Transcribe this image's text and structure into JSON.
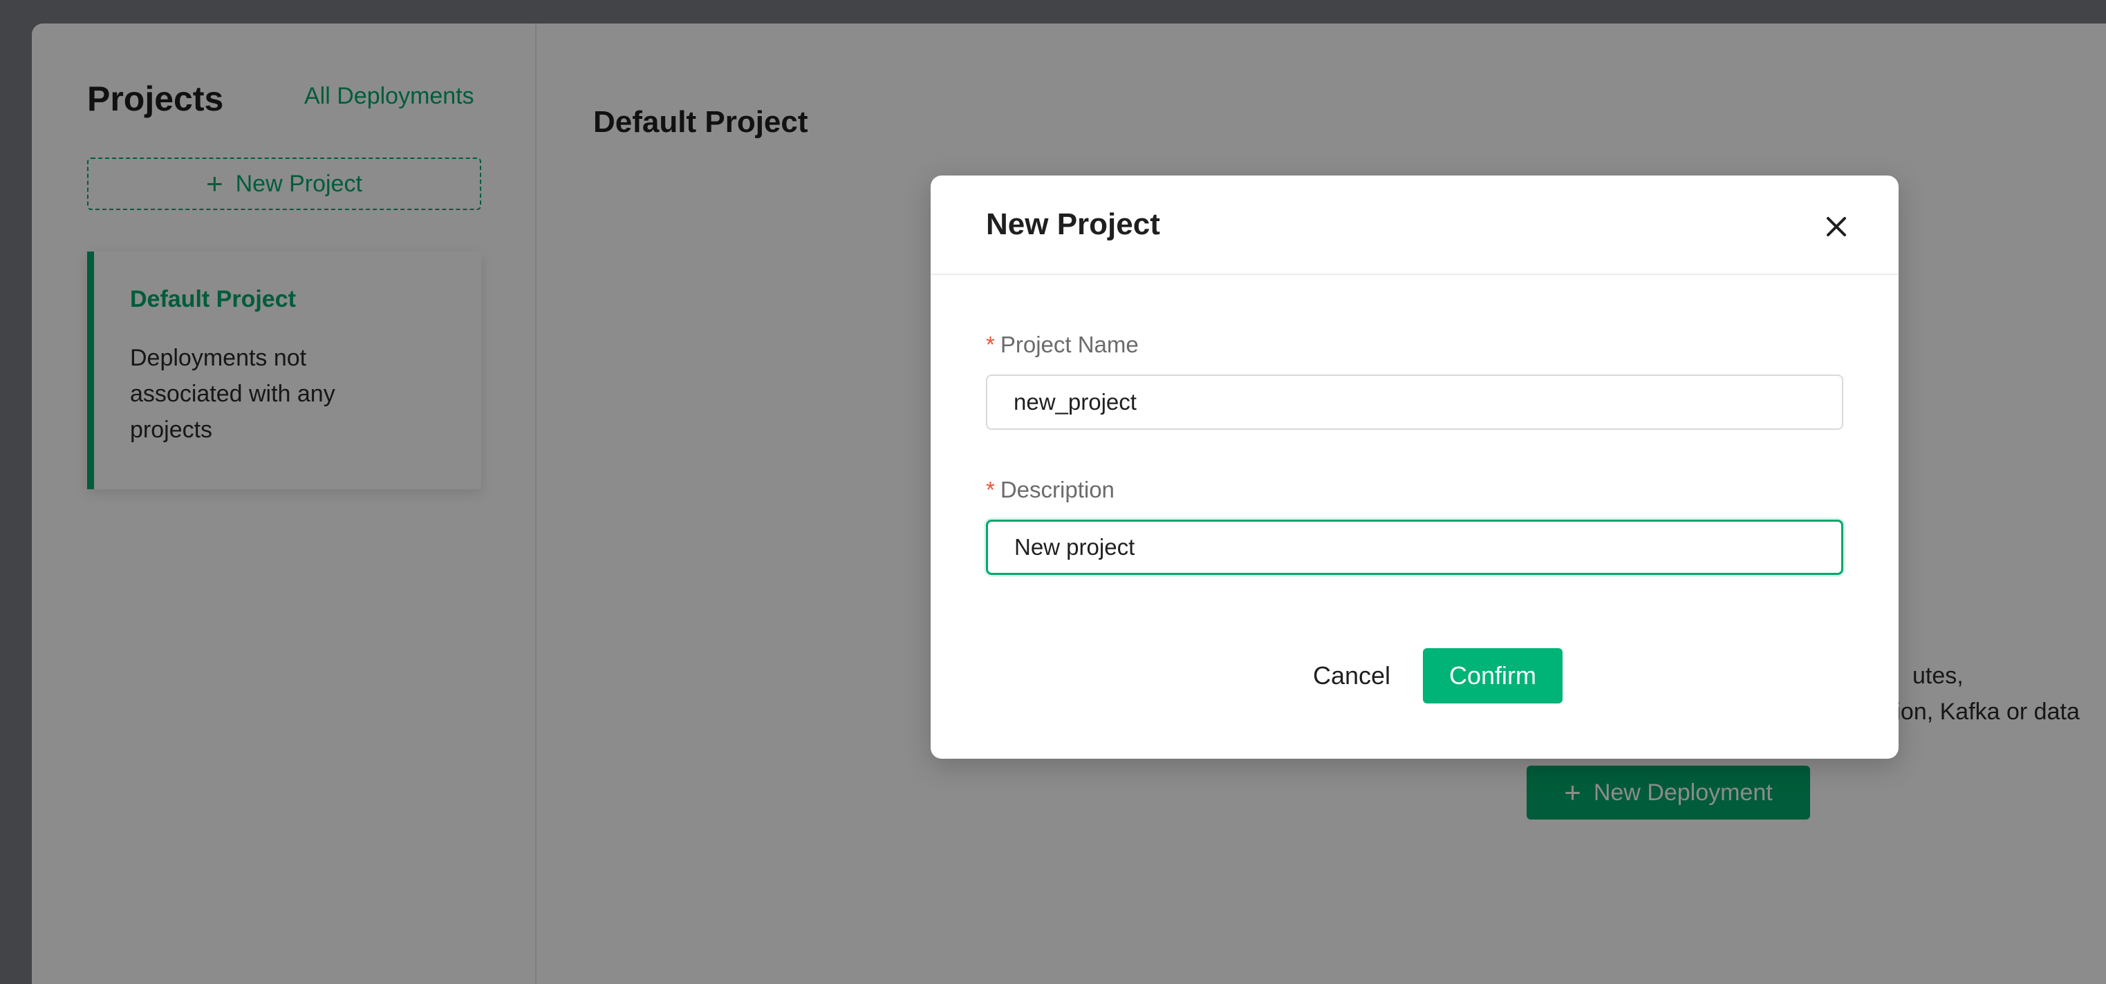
{
  "sidebar": {
    "title": "Projects",
    "all_deployments_link": "All Deployments",
    "new_project_label": "New Project",
    "projects": [
      {
        "name": "Default Project",
        "description": "Deployments not associated with any projects"
      }
    ]
  },
  "main": {
    "title": "Default Project",
    "partial_text_line1": "utes,",
    "partial_text_line2": "cation, Kafka or data",
    "new_deployment_label": "New Deployment"
  },
  "modal": {
    "title": "New Project",
    "required_marker": "*",
    "project_name_label": "Project Name",
    "project_name_value": "new_project",
    "description_label": "Description",
    "description_value": "New project",
    "cancel_label": "Cancel",
    "confirm_label": "Confirm"
  },
  "colors": {
    "accent": "#00a86b",
    "confirm": "#00b377",
    "required": "#e8553a"
  }
}
